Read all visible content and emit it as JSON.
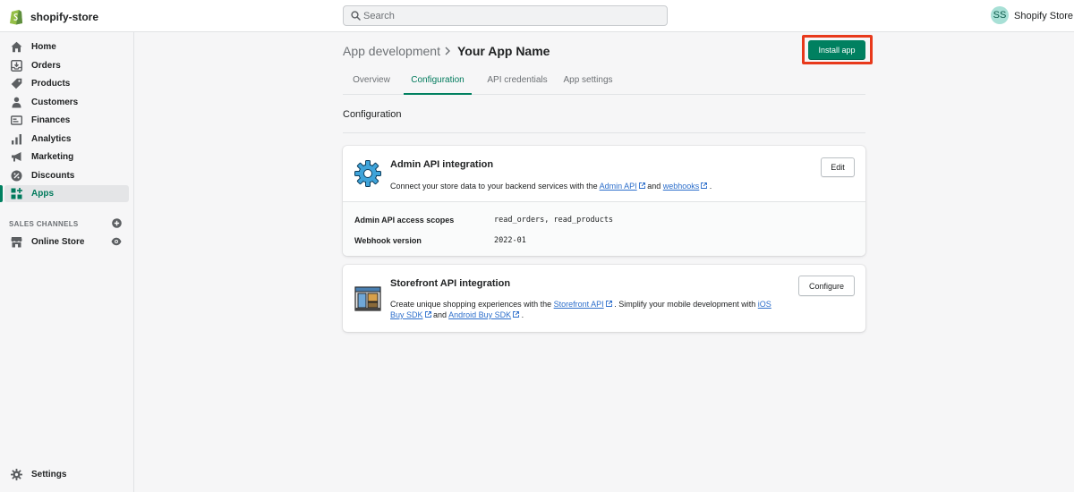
{
  "header": {
    "store_name": "shopify-store",
    "search_placeholder": "Search",
    "user_initials": "SS",
    "user_name": "Shopify Store"
  },
  "sidebar": {
    "items": [
      {
        "label": "Home",
        "icon": "home-icon"
      },
      {
        "label": "Orders",
        "icon": "orders-icon"
      },
      {
        "label": "Products",
        "icon": "tag-icon"
      },
      {
        "label": "Customers",
        "icon": "person-icon"
      },
      {
        "label": "Finances",
        "icon": "finances-icon"
      },
      {
        "label": "Analytics",
        "icon": "bar-chart-icon"
      },
      {
        "label": "Marketing",
        "icon": "megaphone-icon"
      },
      {
        "label": "Discounts",
        "icon": "discount-icon"
      },
      {
        "label": "Apps",
        "icon": "apps-icon",
        "active": true
      }
    ],
    "sales_channels_title": "SALES CHANNELS",
    "online_store_label": "Online Store",
    "settings_label": "Settings"
  },
  "page": {
    "breadcrumb_parent": "App development",
    "title": "Your App Name",
    "install_label": "Install app",
    "accent_color": "#008060",
    "highlight_color": "#e8391b"
  },
  "tabs": [
    {
      "label": "Overview"
    },
    {
      "label": "Configuration",
      "active": true
    },
    {
      "label": "API credentials"
    },
    {
      "label": "App settings"
    }
  ],
  "configuration": {
    "heading": "Configuration",
    "admin_card": {
      "title": "Admin API integration",
      "desc_prefix": "Connect your store data to your backend services with the",
      "link_admin_api": "Admin API",
      "desc_and": "and",
      "link_webhooks": "webhooks",
      "desc_suffix": ".",
      "edit_label": "Edit",
      "scopes_label": "Admin API access scopes",
      "scopes_value": "read_orders, read_products",
      "webhook_label": "Webhook version",
      "webhook_value": "2022-01"
    },
    "storefront_card": {
      "title": "Storefront API integration",
      "desc_prefix": "Create unique shopping experiences with the",
      "link_storefront_api": "Storefront API",
      "desc_middle": ". Simplify your mobile development with",
      "link_ios_sdk": "iOS Buy SDK",
      "desc_and": "and",
      "link_android_sdk": "Android Buy SDK",
      "desc_suffix": ".",
      "configure_label": "Configure"
    }
  }
}
